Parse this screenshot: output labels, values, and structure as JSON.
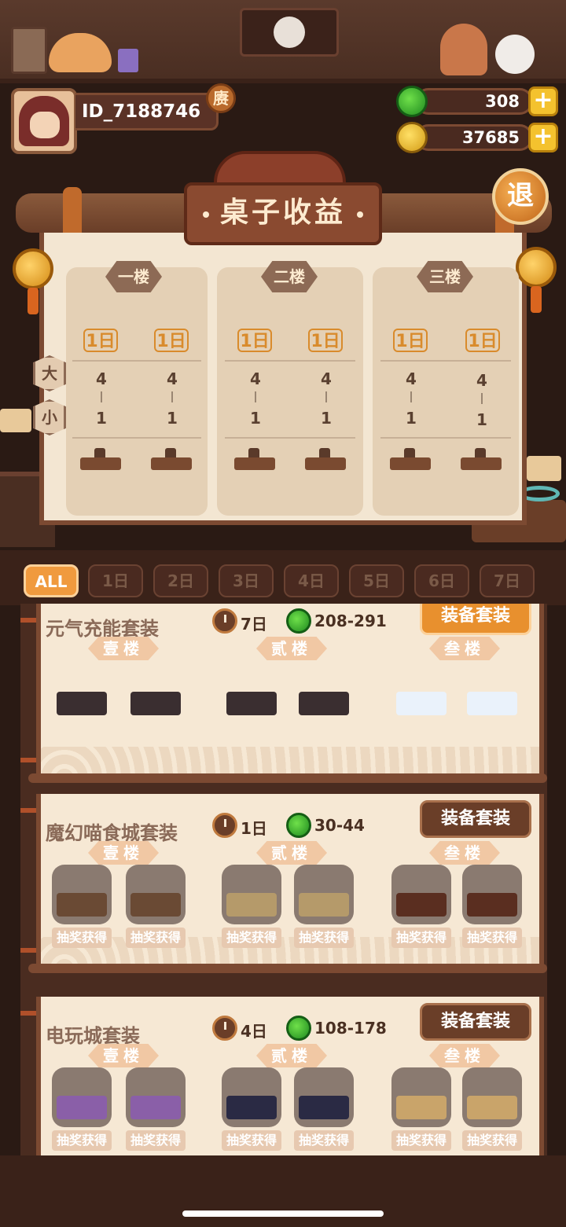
{
  "profile": {
    "id": "ID_7188746",
    "vip_badge": "赓"
  },
  "currency": {
    "jade": "308",
    "coins": "37685",
    "add_label": "+"
  },
  "board": {
    "title": "桌子收益",
    "exit_label": "退",
    "size_tags": [
      "大",
      "小"
    ],
    "floors": [
      {
        "name": "一楼",
        "days": [
          "1日",
          "1日"
        ],
        "big": [
          "4",
          "4"
        ],
        "small": [
          "1",
          "1"
        ]
      },
      {
        "name": "二楼",
        "days": [
          "1日",
          "1日"
        ],
        "big": [
          "4",
          "4"
        ],
        "small": [
          "1",
          "1"
        ]
      },
      {
        "name": "三楼",
        "days": [
          "1日",
          "1日"
        ],
        "big": [
          "4",
          "4"
        ],
        "small": [
          "1",
          "1"
        ]
      }
    ]
  },
  "filters": [
    "ALL",
    "1日",
    "2日",
    "3日",
    "4日",
    "5日",
    "6日",
    "7日"
  ],
  "active_filter": "ALL",
  "sets": [
    {
      "name": "元气充能套装",
      "days": "7日",
      "range": "208-291",
      "button": "装备套装",
      "button_state": "equipped",
      "floor_labels": [
        "壹楼",
        "贰楼",
        "叁楼"
      ],
      "locked": false,
      "lottery": []
    },
    {
      "name": "魔幻喵食城套装",
      "days": "1日",
      "range": "30-44",
      "button": "装备套装",
      "button_state": "normal",
      "floor_labels": [
        "壹楼",
        "贰楼",
        "叁楼"
      ],
      "locked": true,
      "lottery": [
        "抽奖获得",
        "抽奖获得",
        "抽奖获得",
        "抽奖获得",
        "抽奖获得",
        "抽奖获得"
      ]
    },
    {
      "name": "电玩城套装",
      "days": "4日",
      "range": "108-178",
      "button": "装备套装",
      "button_state": "normal",
      "floor_labels": [
        "壹楼",
        "贰楼",
        "叁楼"
      ],
      "locked": true,
      "lottery": [
        "抽奖获得",
        "抽奖获得",
        "抽奖获得",
        "抽奖获得",
        "抽奖获得",
        "抽奖获得"
      ]
    }
  ],
  "colors": {
    "accent": "#f09a3e",
    "wood": "#7c4a32",
    "paper": "#f3e6d2"
  }
}
